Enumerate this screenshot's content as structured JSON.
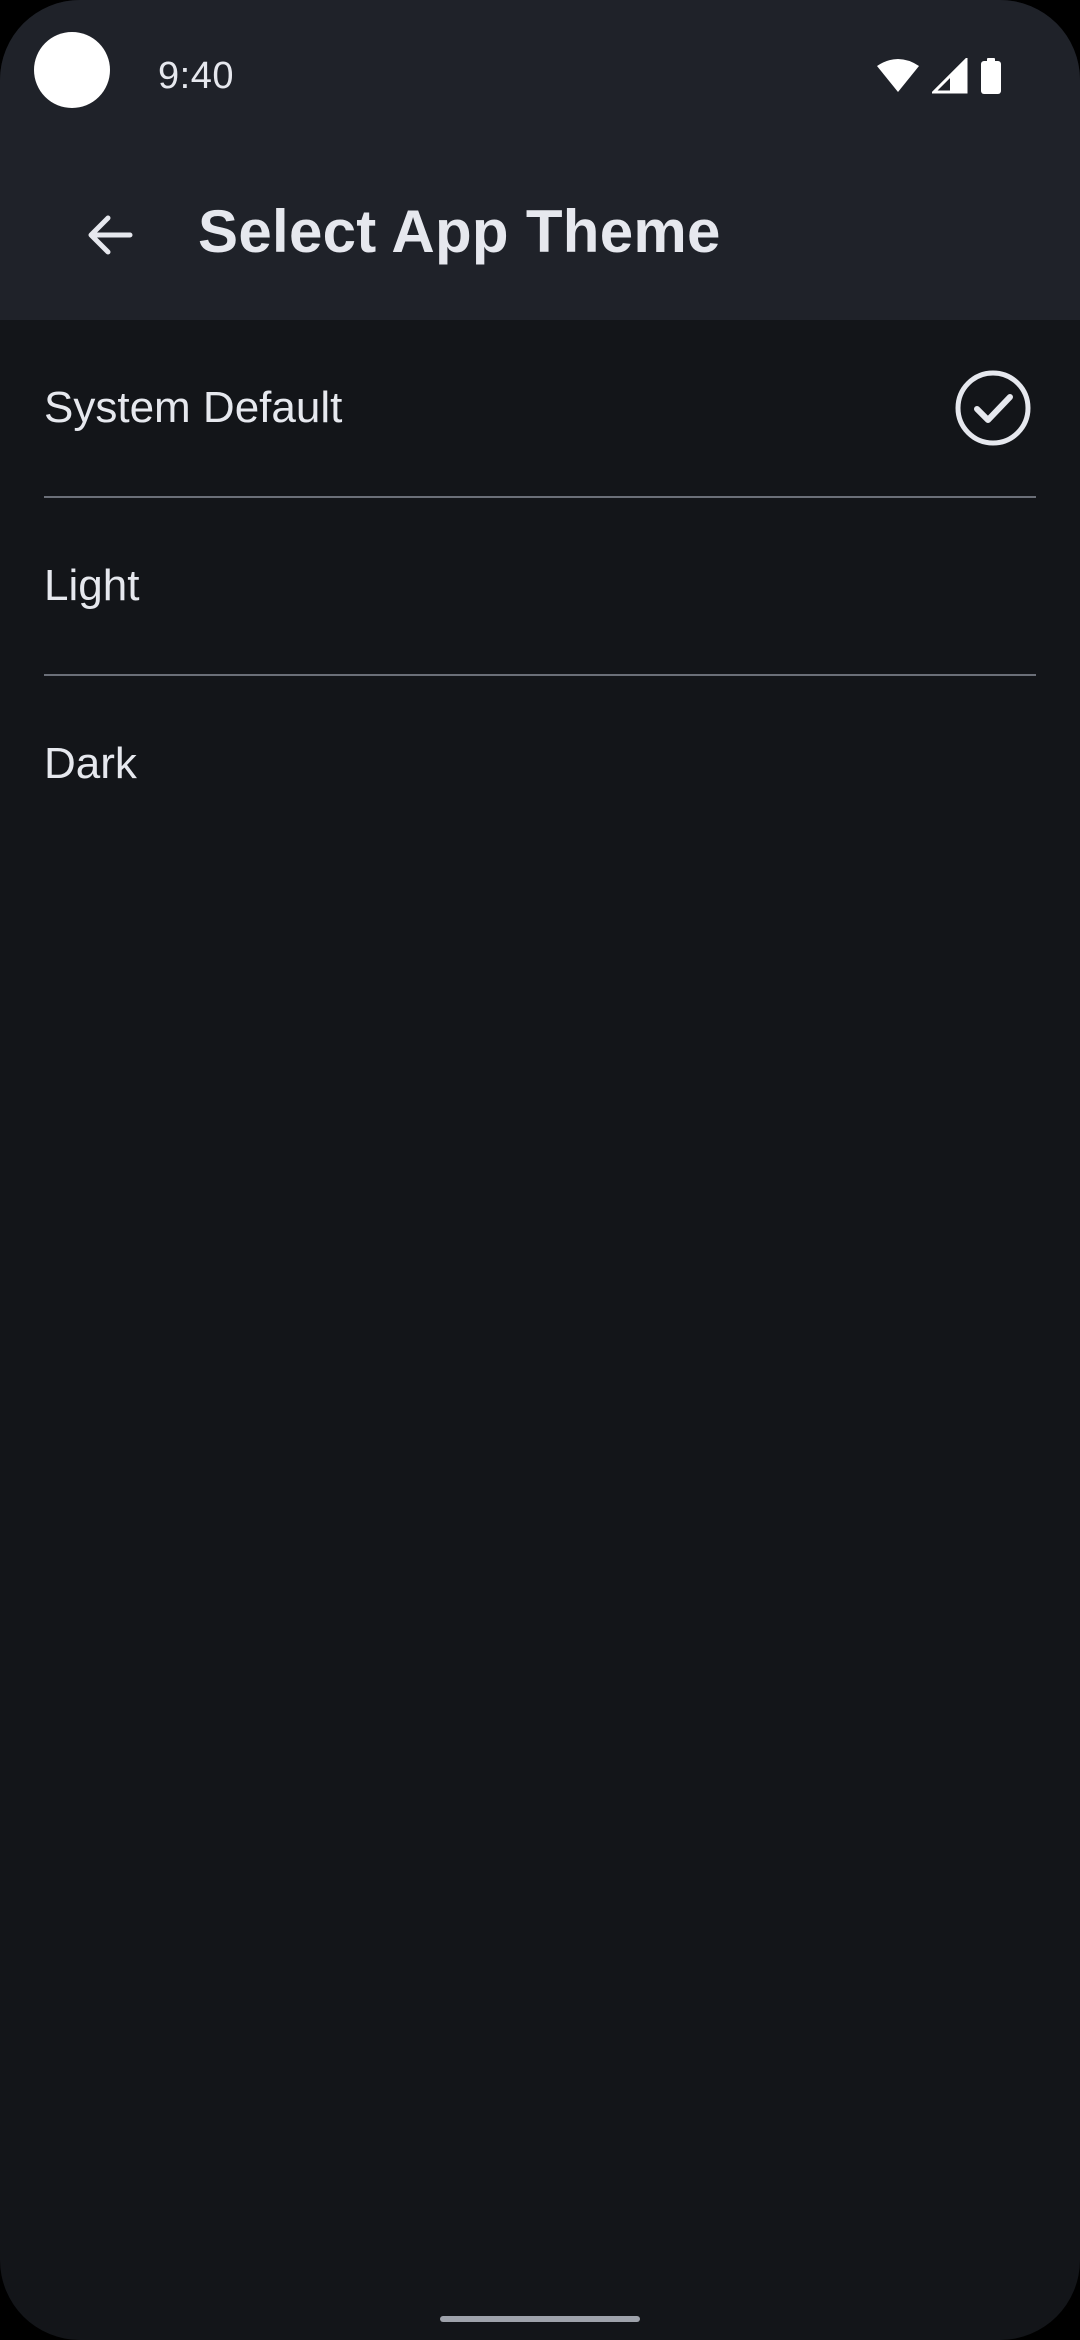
{
  "status_bar": {
    "time": "9:40",
    "icons": [
      "camera-cutout",
      "wifi-icon",
      "cellular-signal-icon",
      "battery-icon"
    ]
  },
  "app_bar": {
    "back_icon": "arrow-left-icon",
    "title": "Select App Theme"
  },
  "theme_options": [
    {
      "label": "System Default",
      "selected": true,
      "icon": "check-circle-icon"
    },
    {
      "label": "Light",
      "selected": false
    },
    {
      "label": "Dark",
      "selected": false
    }
  ],
  "colors": {
    "background": "#131519",
    "app_bar_background": "#1f2229",
    "text": "#e6e8ee",
    "divider": "#6b6f78"
  }
}
